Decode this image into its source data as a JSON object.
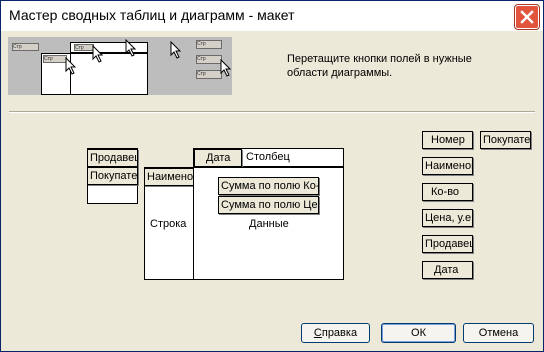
{
  "window": {
    "title": "Мастер сводных таблиц и диаграмм - макет"
  },
  "preview": {
    "mini_labels": [
      "Стр",
      "Стр",
      "Стр",
      "Стр",
      "Стр",
      "Стр",
      "Стр",
      "Стр",
      "Стр"
    ]
  },
  "instruction": "Перетащите кнопки полей в нужные области диаграммы.",
  "layout": {
    "page_fields": [
      "Продавец",
      "Покупатель"
    ],
    "row_field": "Наименование",
    "column_fields": [
      "Дата"
    ],
    "data_fields": [
      "Сумма по полю Ко-во",
      "Сумма по полю Цена"
    ],
    "labels": {
      "column": "Столбец",
      "row": "Строка",
      "data": "Данные"
    }
  },
  "fields": [
    "Номер",
    "Покупатель",
    "Наименование",
    "Ко-во",
    "Цена, у.е.",
    "Продавец",
    "Дата"
  ],
  "buttons": {
    "help": "Справка",
    "ok": "ОК",
    "cancel": "Отмена"
  }
}
